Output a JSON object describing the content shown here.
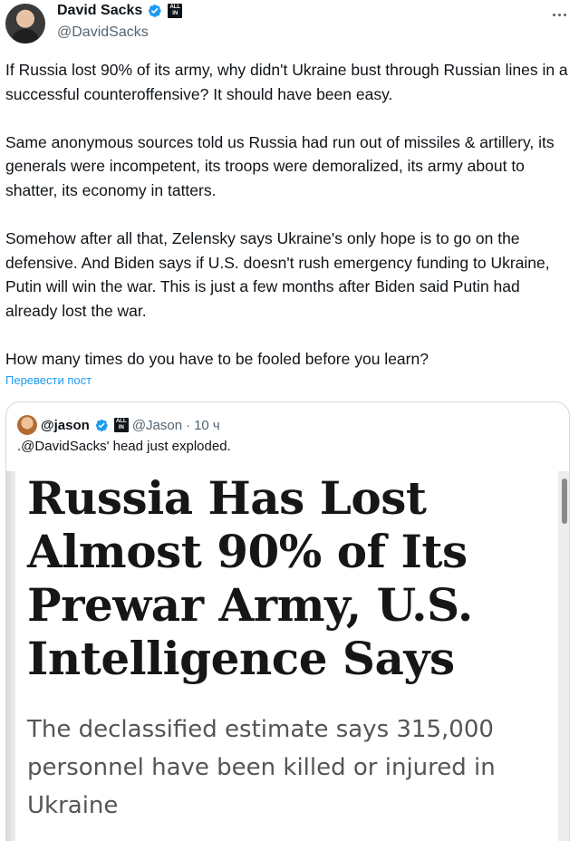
{
  "author": {
    "name": "David Sacks",
    "handle": "@DavidSacks",
    "badge_text": "ALL IN"
  },
  "tweet": {
    "paragraphs": [
      "If Russia lost 90% of its army, why didn't Ukraine bust through Russian lines in a successful counteroffensive? It should have been easy.",
      "Same anonymous sources told us Russia had run out of missiles & artillery, its generals were incompetent, its troops were demoralized, its army about to shatter, its economy in tatters.",
      "Somehow after all that, Zelensky says Ukraine's only hope is to go on the defensive. And Biden says if U.S. doesn't rush emergency funding to Ukraine, Putin will win the war. This is just a few months after Biden said Putin had already lost the war.",
      "How many times do you have to be fooled before you learn?"
    ],
    "translate_label": "Перевести пост"
  },
  "quote": {
    "name": "@jason",
    "badge_text": "ALL IN",
    "handle": "@Jason",
    "separator": "·",
    "time": "10 ч",
    "text": ".@DavidSacks' head just exploded.",
    "image": {
      "headline": "Russia Has Lost Almost 90% of Its Prewar Army, U.S. Intelligence Says",
      "subhead": "The declassified estimate says 315,000 personnel have been killed or injured in Ukraine"
    }
  },
  "colors": {
    "accent": "#1d9bf0",
    "text": "#0f1419",
    "muted": "#536471",
    "border": "#cfd9de"
  },
  "icons": {
    "verified": "verified-badge-icon",
    "more": "more-icon"
  }
}
